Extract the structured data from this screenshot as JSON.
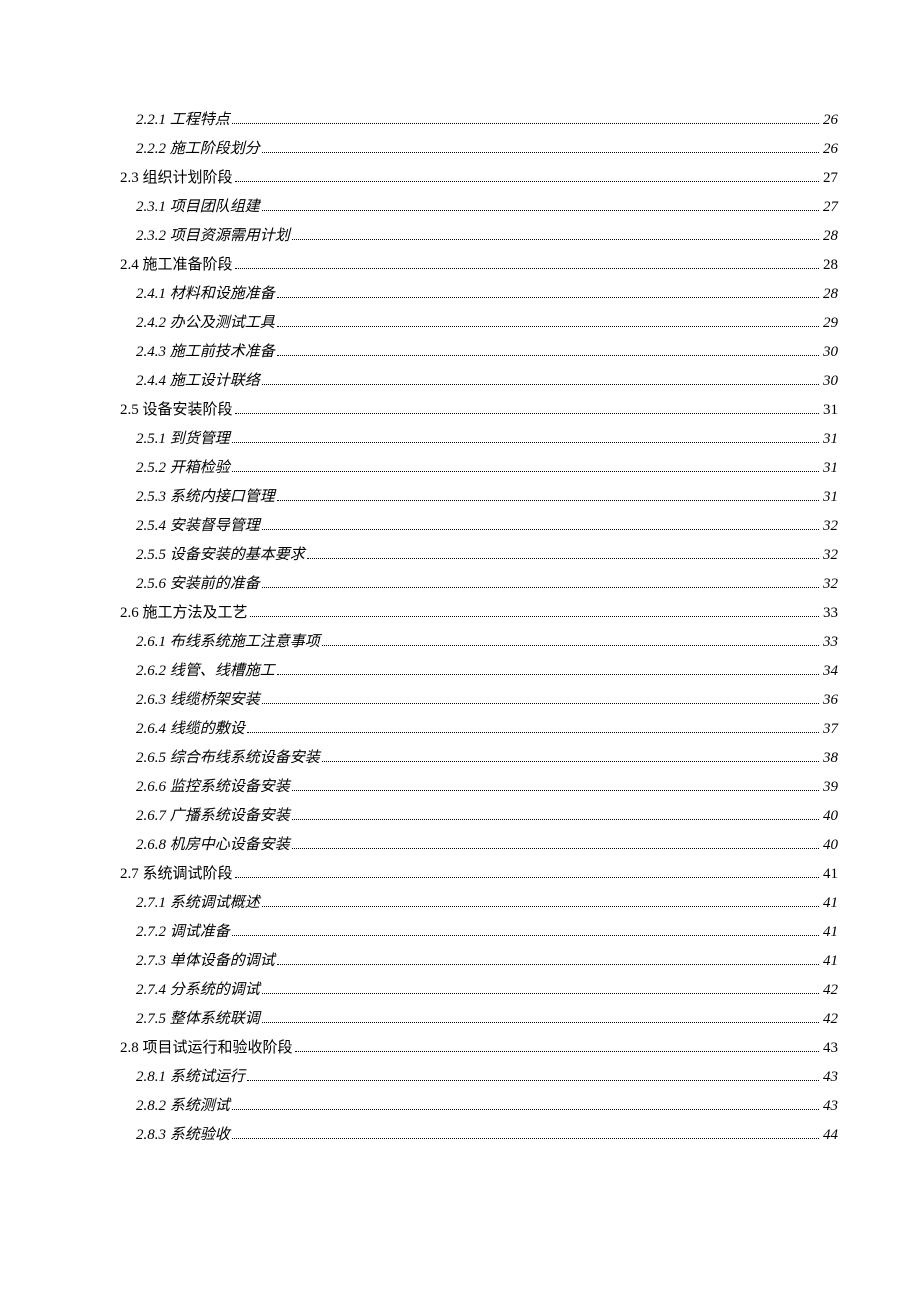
{
  "toc": [
    {
      "level": 3,
      "label": "2.2.1 工程特点",
      "page": "26"
    },
    {
      "level": 3,
      "label": "2.2.2 施工阶段划分",
      "page": "26"
    },
    {
      "level": 2,
      "label": "2.3 组织计划阶段",
      "page": "27"
    },
    {
      "level": 3,
      "label": "2.3.1 项目团队组建",
      "page": "27"
    },
    {
      "level": 3,
      "label": "2.3.2 项目资源需用计划",
      "page": "28"
    },
    {
      "level": 2,
      "label": "2.4 施工准备阶段",
      "page": "28"
    },
    {
      "level": 3,
      "label": "2.4.1 材料和设施准备",
      "page": "28"
    },
    {
      "level": 3,
      "label": "2.4.2 办公及测试工具",
      "page": "29"
    },
    {
      "level": 3,
      "label": "2.4.3 施工前技术准备",
      "page": "30"
    },
    {
      "level": 3,
      "label": "2.4.4 施工设计联络",
      "page": "30"
    },
    {
      "level": 2,
      "label": "2.5 设备安装阶段",
      "page": "31"
    },
    {
      "level": 3,
      "label": "2.5.1 到货管理",
      "page": "31"
    },
    {
      "level": 3,
      "label": "2.5.2 开箱检验",
      "page": "31"
    },
    {
      "level": 3,
      "label": "2.5.3 系统内接口管理",
      "page": "31"
    },
    {
      "level": 3,
      "label": "2.5.4 安装督导管理",
      "page": "32"
    },
    {
      "level": 3,
      "label": "2.5.5 设备安装的基本要求",
      "page": "32"
    },
    {
      "level": 3,
      "label": "2.5.6 安装前的准备",
      "page": "32"
    },
    {
      "level": 2,
      "label": "2.6 施工方法及工艺",
      "page": "33"
    },
    {
      "level": 3,
      "label": "2.6.1 布线系统施工注意事项",
      "page": "33"
    },
    {
      "level": 3,
      "label": "2.6.2 线管、线槽施工",
      "page": "34"
    },
    {
      "level": 3,
      "label": "2.6.3 线缆桥架安装",
      "page": "36"
    },
    {
      "level": 3,
      "label": "2.6.4 线缆的敷设",
      "page": "37"
    },
    {
      "level": 3,
      "label": "2.6.5 综合布线系统设备安装",
      "page": "38"
    },
    {
      "level": 3,
      "label": "2.6.6 监控系统设备安装",
      "page": "39"
    },
    {
      "level": 3,
      "label": "2.6.7 广播系统设备安装",
      "page": "40"
    },
    {
      "level": 3,
      "label": "2.6.8 机房中心设备安装",
      "page": "40"
    },
    {
      "level": 2,
      "label": "2.7 系统调试阶段",
      "page": "41"
    },
    {
      "level": 3,
      "label": "2.7.1 系统调试概述",
      "page": "41"
    },
    {
      "level": 3,
      "label": "2.7.2 调试准备",
      "page": "41"
    },
    {
      "level": 3,
      "label": "2.7.3 单体设备的调试",
      "page": "41"
    },
    {
      "level": 3,
      "label": "2.7.4 分系统的调试",
      "page": "42"
    },
    {
      "level": 3,
      "label": "2.7.5 整体系统联调",
      "page": "42"
    },
    {
      "level": 2,
      "label": "2.8 项目试运行和验收阶段",
      "page": "43"
    },
    {
      "level": 3,
      "label": "2.8.1 系统试运行",
      "page": "43"
    },
    {
      "level": 3,
      "label": "2.8.2 系统测试",
      "page": "43"
    },
    {
      "level": 3,
      "label": "2.8.3 系统验收",
      "page": "44"
    }
  ]
}
